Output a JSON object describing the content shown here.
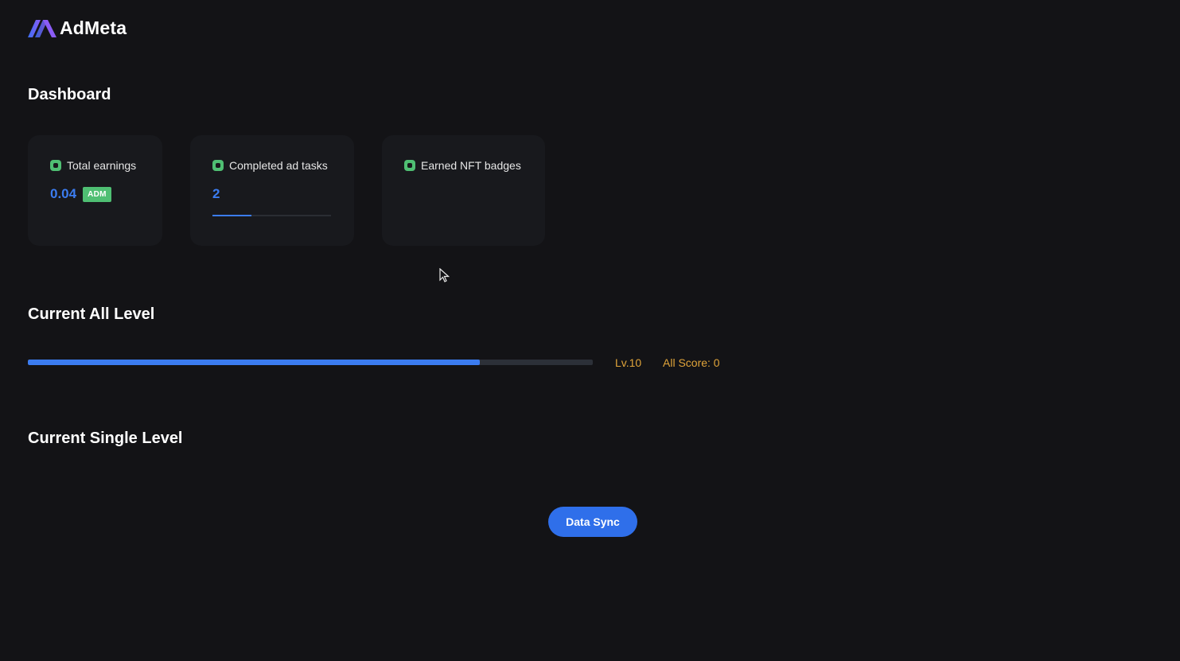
{
  "app": {
    "name": "AdMeta"
  },
  "dashboard": {
    "title": "Dashboard",
    "cards": [
      {
        "label": "Total earnings",
        "value": "0.04",
        "badge": "ADM"
      },
      {
        "label": "Completed ad tasks",
        "value": "2",
        "progress": 0.33
      },
      {
        "label": "Earned NFT badges"
      }
    ]
  },
  "all_level": {
    "title": "Current All Level",
    "progress": 0.8,
    "level": "Lv.10",
    "score": "All Score: 0"
  },
  "single_level": {
    "title": "Current Single Level"
  },
  "sync_button": {
    "label": "Data Sync"
  },
  "colors": {
    "accent": "#3b7cf0",
    "badge": "#4fbf73",
    "level_text": "#e0a43a",
    "background": "#131316"
  },
  "icons": {
    "card_dot": "status-dot-icon",
    "logo": "admeta-logo-icon",
    "cursor": "cursor-arrow-icon"
  }
}
